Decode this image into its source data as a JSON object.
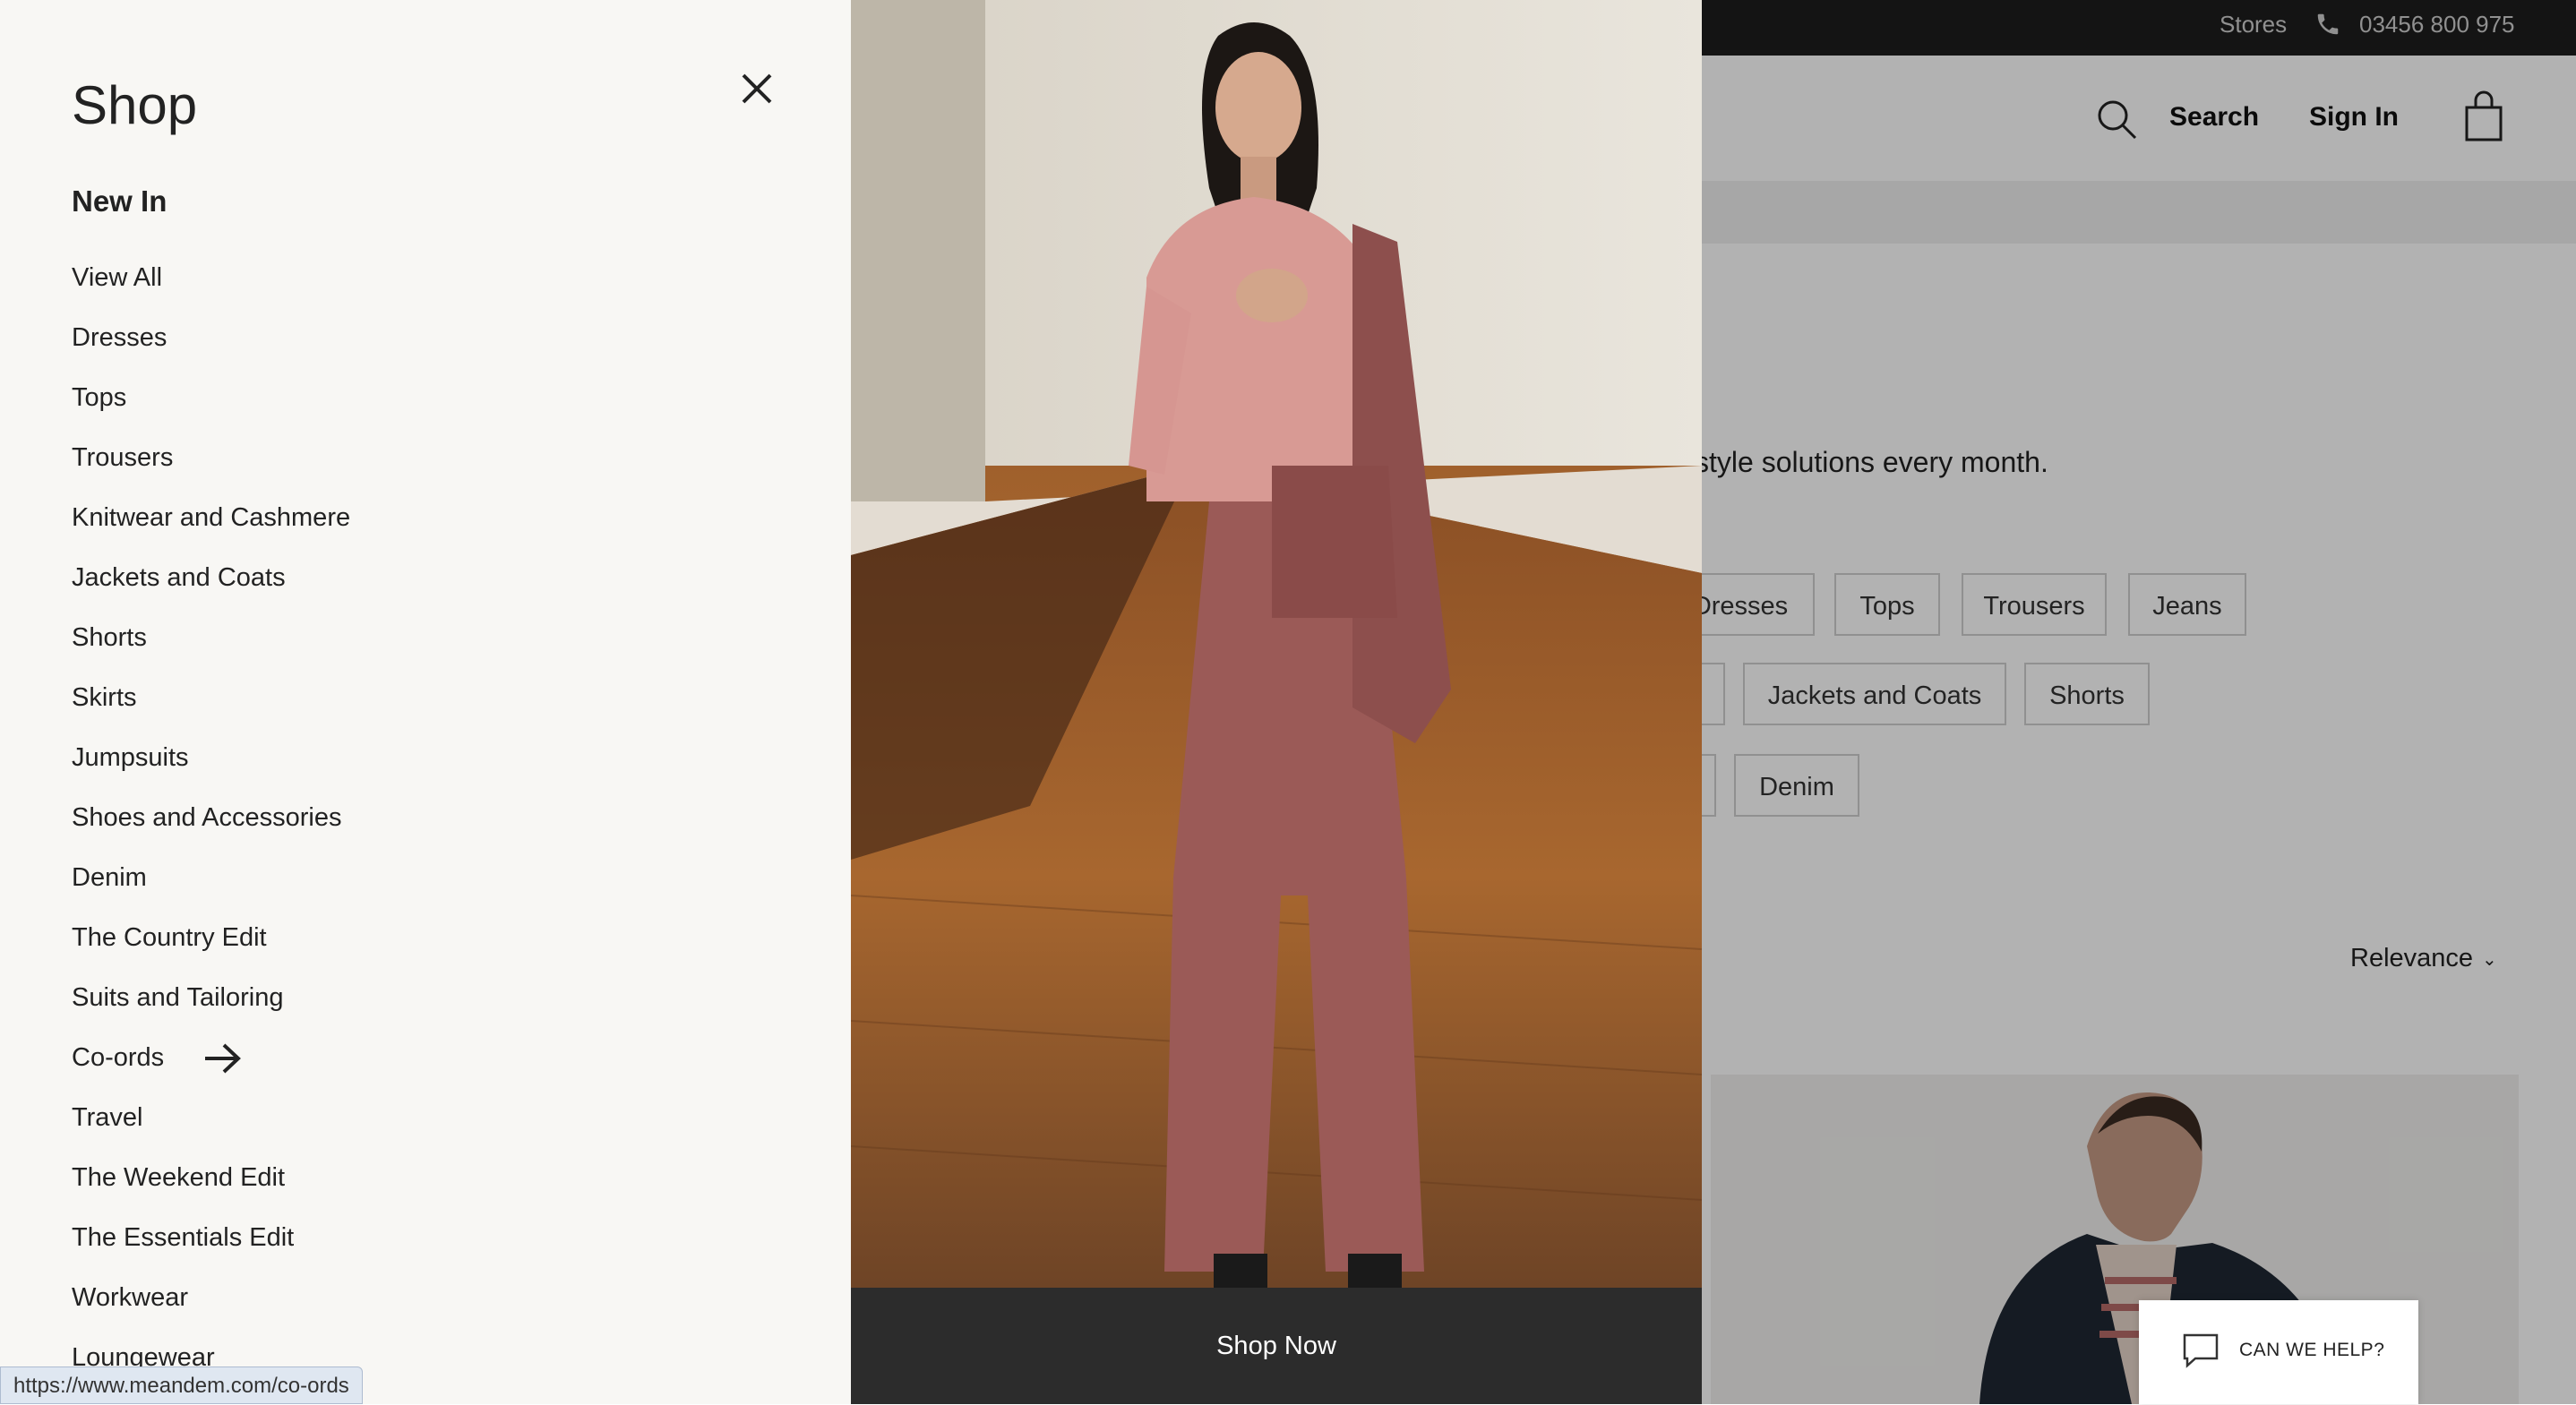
{
  "topbar": {
    "stores": "Stores",
    "phone": "03456 800 975"
  },
  "header": {
    "search": "Search",
    "sign_in": "Sign In"
  },
  "intro_text": "w style solutions every month.",
  "chips": {
    "row1": [
      "Dresses",
      "Tops",
      "Trousers",
      "Jeans"
    ],
    "row2": [
      "Jackets and Coats",
      "Shorts"
    ],
    "row3": [
      "Denim"
    ]
  },
  "sort": {
    "label": "Relevance"
  },
  "chat": {
    "label": "CAN WE HELP?"
  },
  "drawer": {
    "title": "Shop",
    "section": "New In",
    "items": [
      "View All",
      "Dresses",
      "Tops",
      "Trousers",
      "Knitwear and Cashmere",
      "Jackets and Coats",
      "Shorts",
      "Skirts",
      "Jumpsuits",
      "Shoes and Accessories",
      "Denim",
      "The Country Edit",
      "Suits and Tailoring",
      "Co-ords",
      "Travel",
      "The Weekend Edit",
      "The Essentials Edit",
      "Workwear",
      "Loungewear"
    ],
    "hovered_item": "Co-ords"
  },
  "feature": {
    "cta": "Shop Now"
  },
  "status_url": "https://www.meandem.com/co-ords",
  "icons": [
    "close-icon",
    "arrow-right-icon",
    "search-icon",
    "bag-icon",
    "phone-icon",
    "chat-icon"
  ],
  "colors": {
    "drawer_bg": "#f8f7f4",
    "topbar_bg": "#1e1e1e",
    "cta_bg": "#2c2c2c"
  }
}
